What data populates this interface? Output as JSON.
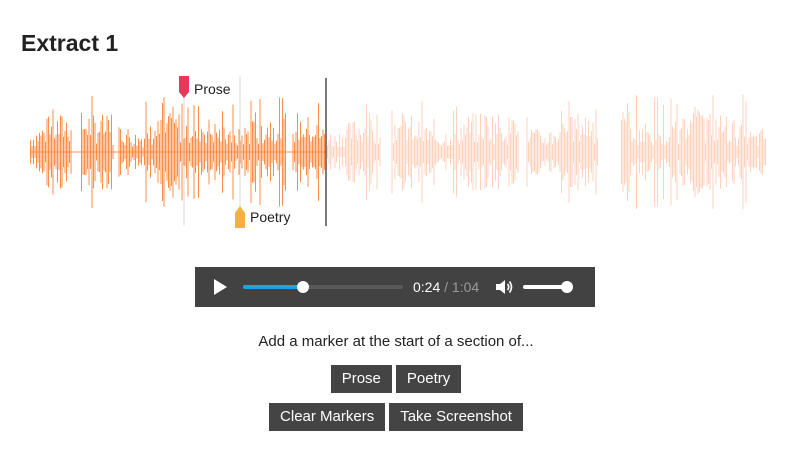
{
  "title": "Extract 1",
  "waveform": {
    "played_color": "#ff8c47",
    "unplayed_color": "#ffd2bc",
    "playhead_color": "#222222",
    "markers": [
      {
        "label": "Prose",
        "color": "#e8385a",
        "type": "prose"
      },
      {
        "label": "Poetry",
        "color": "#f5b041",
        "type": "poetry"
      }
    ]
  },
  "player": {
    "current_time": "0:24",
    "separator": "/",
    "duration": "1:04",
    "progress_fraction": 0.375,
    "volume_fraction": 1.0,
    "accent_color": "#1ba3e8",
    "play_icon": "play-icon",
    "volume_icon": "volume-icon"
  },
  "instruction": "Add a marker at the start of a section of...",
  "buttons": {
    "prose": "Prose",
    "poetry": "Poetry",
    "clear": "Clear Markers",
    "screenshot": "Take Screenshot"
  }
}
